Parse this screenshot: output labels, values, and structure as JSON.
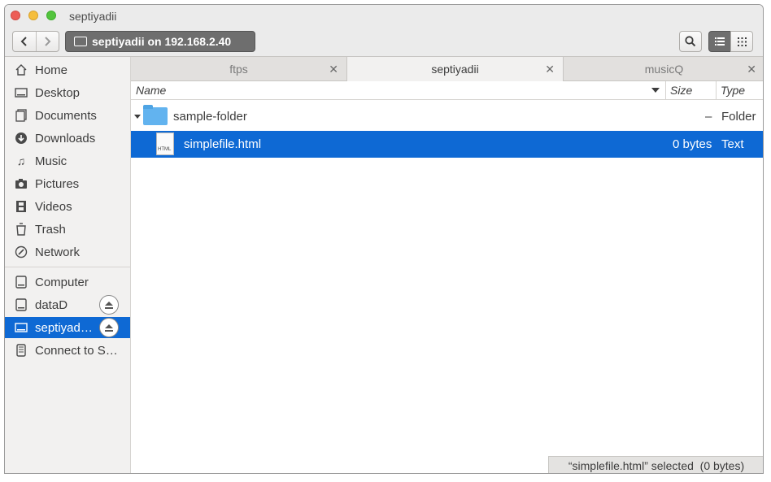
{
  "window": {
    "title": "septiyadii"
  },
  "toolbar": {
    "back_icon": "chevron-left-icon",
    "forward_icon": "chevron-right-icon",
    "location": "septiyadii on 192.168.2.40",
    "search_icon": "search-icon",
    "list_view_icon": "list-view-icon",
    "grid_view_icon": "grid-view-icon"
  },
  "sidebar": {
    "places": [
      {
        "label": "Home",
        "icon": "home-icon"
      },
      {
        "label": "Desktop",
        "icon": "desktop-icon"
      },
      {
        "label": "Documents",
        "icon": "documents-icon"
      },
      {
        "label": "Downloads",
        "icon": "downloads-icon"
      },
      {
        "label": "Music",
        "icon": "music-icon"
      },
      {
        "label": "Pictures",
        "icon": "pictures-icon"
      },
      {
        "label": "Videos",
        "icon": "videos-icon"
      },
      {
        "label": "Trash",
        "icon": "trash-icon"
      },
      {
        "label": "Network",
        "icon": "network-icon"
      }
    ],
    "devices": [
      {
        "label": "Computer",
        "icon": "computer-icon"
      },
      {
        "label": "dataD",
        "icon": "drive-icon",
        "eject": true
      },
      {
        "label": "septiyad…",
        "icon": "network-folder-icon",
        "eject": true,
        "selected": true
      },
      {
        "label": "Connect to S…",
        "icon": "connect-server-icon"
      }
    ]
  },
  "tabs": [
    {
      "label": "ftps",
      "active": false
    },
    {
      "label": "septiyadii",
      "active": true
    },
    {
      "label": "musicQ",
      "active": false
    }
  ],
  "columns": {
    "name": "Name",
    "size": "Size",
    "type": "Type"
  },
  "files": [
    {
      "name": "sample-folder",
      "size": "–",
      "type": "Folder",
      "kind": "folder",
      "expanded": true
    },
    {
      "name": "simplefile.html",
      "size": "0 bytes",
      "type": "Text",
      "kind": "file",
      "icon_label": "HTML",
      "selected": true
    }
  ],
  "status": {
    "text": "“simplefile.html” selected  (0 bytes)"
  },
  "colors": {
    "selection": "#0e69d4",
    "folder": "#62b3ef"
  }
}
